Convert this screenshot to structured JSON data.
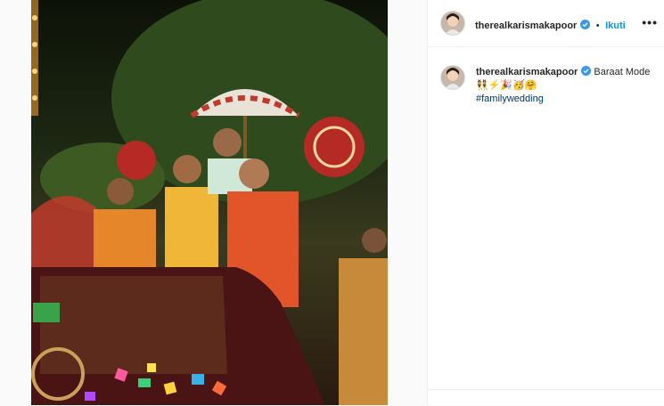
{
  "post": {
    "image_alt": "Wedding baraat procession photo",
    "author": "therealkarismakapoor",
    "follow_label": "Ikuti",
    "more_label": "•••",
    "caption": {
      "author": "therealkarismakapoor",
      "text": "Baraat Mode",
      "emojis": "👯⚡🎉🥳🤗",
      "hashtag": "#familywedding"
    }
  },
  "colors": {
    "accent": "#0095f6",
    "verified": "#3897f0",
    "hashtag": "#00376b"
  }
}
